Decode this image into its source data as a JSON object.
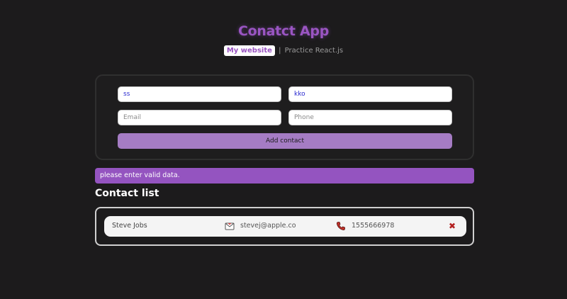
{
  "app": {
    "title": "Conatct App"
  },
  "nav": {
    "website_label": "My website",
    "separator": "|",
    "practice_label": "Practice React.js"
  },
  "form": {
    "first_name_value": "ss",
    "last_name_value": "kko",
    "email_placeholder": "Email",
    "phone_placeholder": "Phone",
    "submit_label": "Add contact"
  },
  "alert": {
    "message": "please enter valid data."
  },
  "contact_list": {
    "heading": "Contact list",
    "items": [
      {
        "name": "Steve Jobs",
        "email": "stevej@apple.co",
        "phone": "1555666978",
        "mail_icon": "envelope-icon",
        "phone_icon": "phone-icon",
        "delete_icon": "close-icon"
      }
    ]
  },
  "colors": {
    "background": "#1c1b1c",
    "accent": "#9a55c2",
    "button": "#a57cc4",
    "alert": "#9454c0",
    "delete": "#b32020"
  }
}
